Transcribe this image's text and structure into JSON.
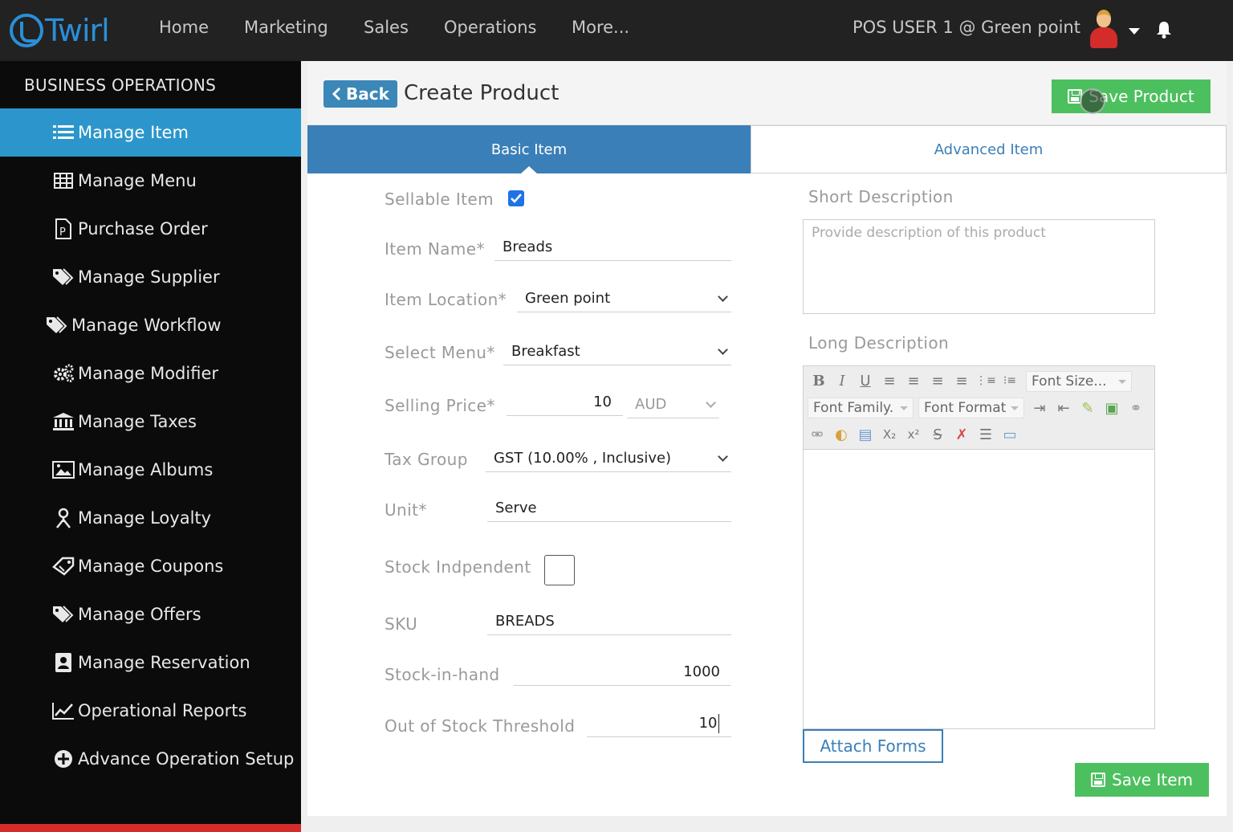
{
  "app": {
    "logo_text": "Twirl",
    "nav": [
      "Home",
      "Marketing",
      "Sales",
      "Operations",
      "More..."
    ],
    "user_label": "POS USER 1 @ Green point"
  },
  "sidebar": {
    "title": "BUSINESS OPERATIONS",
    "items": [
      {
        "label": "Manage Item",
        "icon": "list-icon",
        "active": true
      },
      {
        "label": "Manage Menu",
        "icon": "grid-icon"
      },
      {
        "label": "Purchase Order",
        "icon": "document-p-icon"
      },
      {
        "label": "Manage Supplier",
        "icon": "tags-icon"
      },
      {
        "label": "Manage Workflow",
        "icon": "tags-icon"
      },
      {
        "label": "Manage Modifier",
        "icon": "gears-icon"
      },
      {
        "label": "Manage Taxes",
        "icon": "bank-icon"
      },
      {
        "label": "Manage Albums",
        "icon": "image-icon"
      },
      {
        "label": "Manage Loyalty",
        "icon": "person-icon"
      },
      {
        "label": "Manage Coupons",
        "icon": "ticket-icon"
      },
      {
        "label": "Manage Offers",
        "icon": "tags-icon"
      },
      {
        "label": "Manage Reservation",
        "icon": "contact-icon"
      },
      {
        "label": "Operational Reports",
        "icon": "chart-line-icon"
      },
      {
        "label": "Advance Operation Setup",
        "icon": "plus-circle-icon"
      }
    ]
  },
  "header": {
    "back_label": "Back",
    "title": "Create Product",
    "save_product_label": "Save Product"
  },
  "tabs": {
    "basic": "Basic Item",
    "advanced": "Advanced Item"
  },
  "form": {
    "sellable_label": "Sellable Item",
    "sellable_checked": true,
    "item_name_label": "Item Name*",
    "item_name_value": "Breads",
    "location_label": "Item Location*",
    "location_value": "Green point",
    "menu_label": "Select Menu*",
    "menu_value": "Breakfast",
    "price_label": "Selling Price*",
    "price_value": "10",
    "currency_value": "AUD",
    "tax_label": "Tax Group",
    "tax_value": "GST (10.00% , Inclusive)",
    "unit_label": "Unit*",
    "unit_value": "Serve",
    "stock_indep_label": "Stock Indpendent",
    "stock_indep_checked": false,
    "sku_label": "SKU",
    "sku_value": "BREADS",
    "stock_label": "Stock-in-hand",
    "stock_value": "1000",
    "threshold_label": "Out of Stock Threshold",
    "threshold_value": "10"
  },
  "description": {
    "short_label": "Short Description",
    "short_placeholder": "Provide description of this product",
    "long_label": "Long Description",
    "font_size": "Font Size...",
    "font_family": "Font Family.",
    "font_format": "Font Format"
  },
  "buttons": {
    "attach_forms": "Attach Forms",
    "save_item": "Save Item"
  },
  "colors": {
    "accent": "#2c96cc",
    "tab_active": "#3a7fb8",
    "save_green": "#4cc05e",
    "topbar": "#222222",
    "sidebar": "#0b0b0b"
  }
}
